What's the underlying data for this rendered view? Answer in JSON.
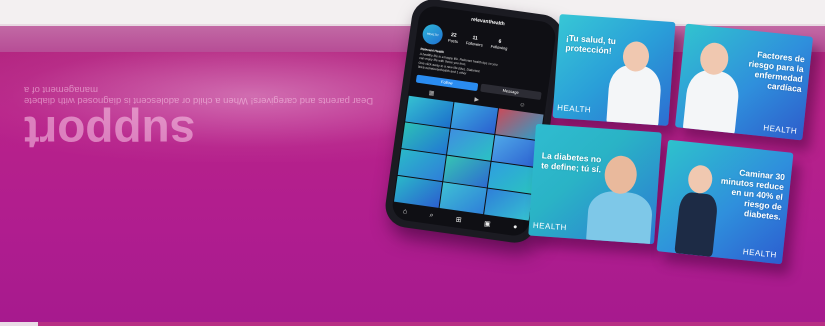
{
  "background_text": {
    "heading": "support",
    "line1": "management of a",
    "line2": "Dear parents and caregivers! When a child or adolescent is diagnosed with diabete"
  },
  "phone": {
    "handle": "relevanthealth",
    "avatar_label": "HEALTH",
    "stats": [
      {
        "value": "22",
        "label": "Posts"
      },
      {
        "value": "11",
        "label": "Followers"
      },
      {
        "value": "6",
        "label": "Following"
      }
    ],
    "bio_title": "Relevant Health",
    "bio_lines": [
      "A healthy life is a happy life. Relevant health tips so you",
      "can enjoy life with those you love.",
      "One click away to a new life (Me). Diabetes!",
      "linktr.ee/relevanthealth and 1 other"
    ],
    "follow_label": "Follow",
    "message_label": "Message"
  },
  "cards": [
    {
      "caption": "¡Tu salud, tu protección!",
      "brand": "HEALTH"
    },
    {
      "caption": "Factores de riesgo para la enfermedad cardíaca",
      "brand": "HEALTH"
    },
    {
      "caption": "La diabetes no te define; tú sí.",
      "brand": "HEALTH"
    },
    {
      "caption": "Caminar 30 minutos reduce en un 40% el riesgo de diabetes.",
      "brand": "HEALTH"
    }
  ],
  "colors": {
    "magenta": "#b01d8f",
    "card_teal": "#2ab8c9",
    "card_blue": "#2f7fd9"
  }
}
